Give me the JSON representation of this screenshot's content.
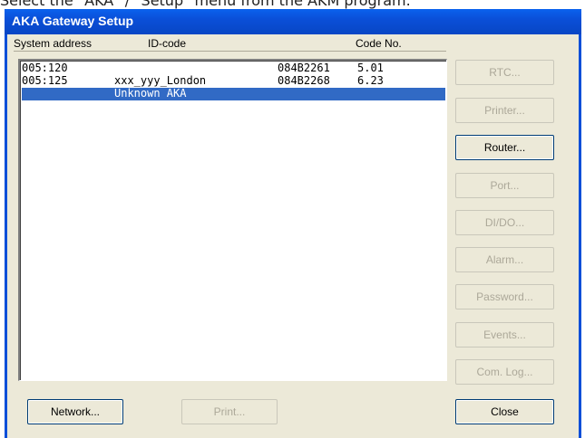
{
  "caption_text": "Select the \"AKA\" / \"Setup\" menu from the AKM program.",
  "window": {
    "title": "AKA Gateway Setup"
  },
  "columns": {
    "address": "System address",
    "id": "ID-code",
    "code": "Code No."
  },
  "rows": [
    {
      "address": "005:120",
      "id": "",
      "code": "084B2261",
      "version": "5.01"
    },
    {
      "address": "005:125",
      "id": "xxx_yyy_London",
      "code": "084B2268",
      "version": "6.23"
    },
    {
      "address": "",
      "id": "Unknown AKA",
      "code": "",
      "version": ""
    }
  ],
  "selected_row": 2,
  "side_buttons": [
    {
      "label": "RTC...",
      "enabled": false
    },
    {
      "label": "Printer...",
      "enabled": false
    },
    {
      "label": "Router...",
      "enabled": true
    },
    {
      "label": "Port...",
      "enabled": false
    },
    {
      "label": "DI/DO...",
      "enabled": false
    },
    {
      "label": "Alarm...",
      "enabled": false
    },
    {
      "label": "Password...",
      "enabled": false
    },
    {
      "label": "Events...",
      "enabled": false
    },
    {
      "label": "Com. Log...",
      "enabled": false
    }
  ],
  "bottom_buttons": {
    "network": {
      "label": "Network...",
      "enabled": true
    },
    "print": {
      "label": "Print...",
      "enabled": false
    },
    "close": {
      "label": "Close",
      "enabled": true
    }
  },
  "colors": {
    "titlebar": "#0a4fd8",
    "selection": "#316ac5",
    "dialog": "#ece9d8"
  }
}
